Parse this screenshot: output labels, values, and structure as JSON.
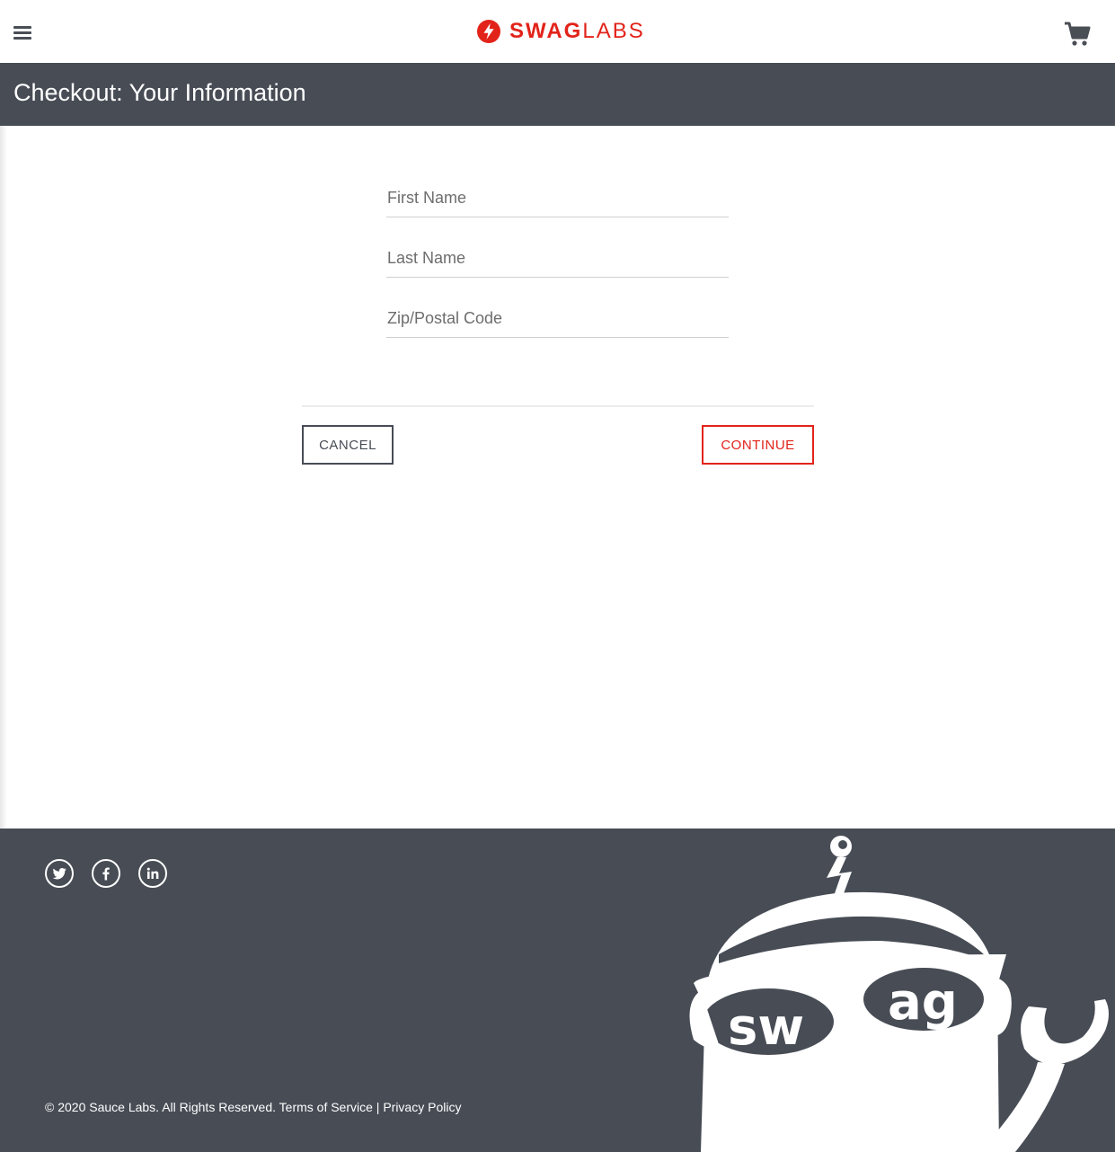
{
  "header": {
    "logo_bold": "SWAG",
    "logo_light": "LABS",
    "menu_icon": "hamburger-menu-icon",
    "cart_icon": "shopping-cart-icon"
  },
  "subheader": {
    "title": "Checkout: Your Information"
  },
  "form": {
    "first_name": {
      "placeholder": "First Name",
      "value": ""
    },
    "last_name": {
      "placeholder": "Last Name",
      "value": ""
    },
    "postal_code": {
      "placeholder": "Zip/Postal Code",
      "value": ""
    }
  },
  "actions": {
    "cancel_label": "CANCEL",
    "continue_label": "CONTINUE"
  },
  "footer": {
    "copyright": "© 2020 Sauce Labs. All Rights Reserved. Terms of Service | Privacy Policy",
    "social": [
      "twitter-icon",
      "facebook-icon",
      "linkedin-icon"
    ],
    "mascot_text": "swag"
  },
  "colors": {
    "brand_red": "#e2231a",
    "bar_gray": "#474c55"
  }
}
